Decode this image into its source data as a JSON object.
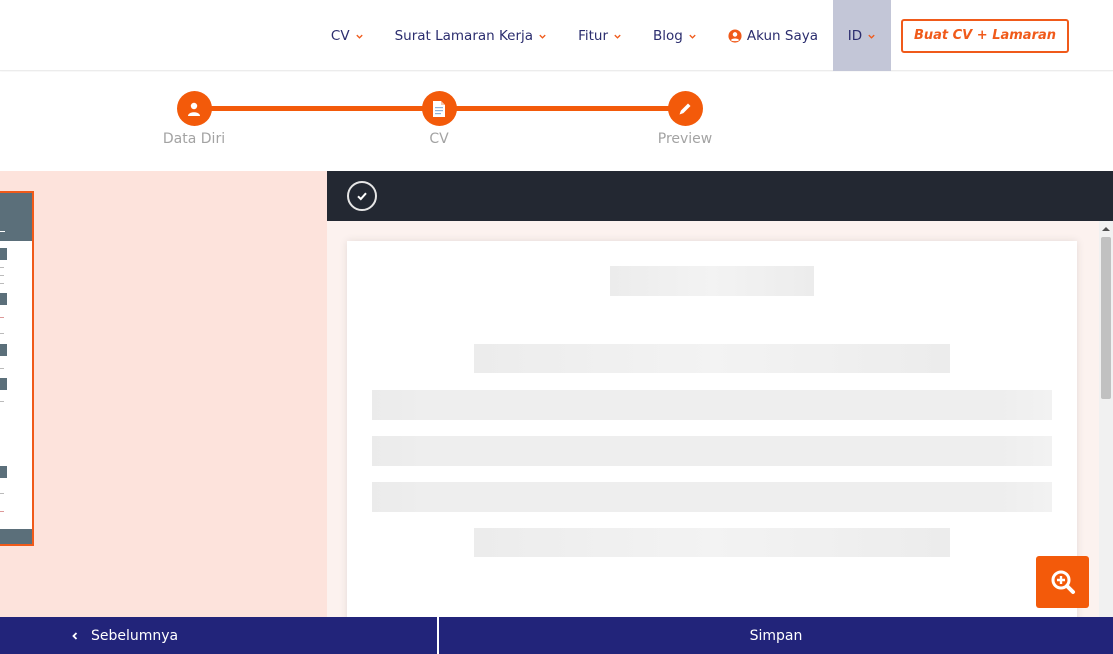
{
  "nav": {
    "items": [
      {
        "label": "CV"
      },
      {
        "label": "Surat Lamaran Kerja"
      },
      {
        "label": "Fitur"
      },
      {
        "label": "Blog"
      }
    ],
    "account_label": "Akun Saya",
    "lang_label": "ID",
    "cta_label": "Buat CV + Lamaran"
  },
  "stepper": {
    "steps": [
      {
        "label": "Data Diri",
        "icon": "user-icon"
      },
      {
        "label": "CV",
        "icon": "document-icon"
      },
      {
        "label": "Preview",
        "icon": "pencil-icon"
      }
    ]
  },
  "footer": {
    "prev_label": "Sebelumnya",
    "save_label": "Simpan"
  },
  "colors": {
    "accent": "#f35a0a",
    "navy": "#22247a",
    "toolbar": "#232832",
    "left_bg": "#fde3dc"
  }
}
